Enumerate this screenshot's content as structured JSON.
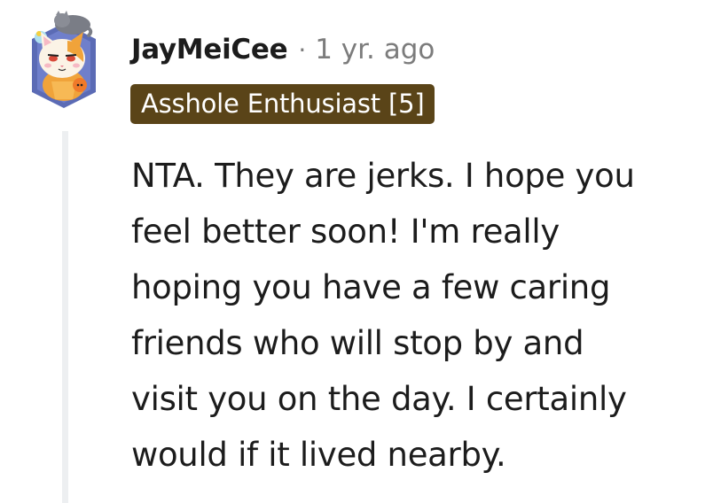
{
  "comment": {
    "username": "JayMeiCee",
    "separator": "·",
    "timestamp": "1 yr. ago",
    "flair": "Asshole Enthusiast [5]",
    "body": "NTA. They are jerks. I hope you\nfeel better soon! I'm really\nhoping you have a few caring\nfriends who will stop by and\nvisit you on the day. I certainly\nwould if it lived nearby.",
    "avatar_icon": "cat-avatar-icon"
  },
  "colors": {
    "flair_background": "#5a4418",
    "flair_text": "#ffffff",
    "meta_text": "#7c7c7c",
    "body_text": "#1c1c1c",
    "thread_line": "#edeff1"
  }
}
